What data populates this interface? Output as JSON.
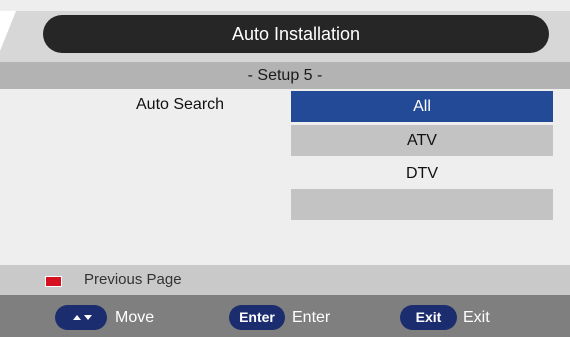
{
  "header": {
    "title": "Auto Installation",
    "subtitle": "- Setup 5 -"
  },
  "auto_search": {
    "label": "Auto Search",
    "options": [
      "All",
      "ATV",
      "DTV",
      ""
    ],
    "selected": "All"
  },
  "footer": {
    "previous_page_label": "Previous Page",
    "red_key_color": "#d6101f",
    "hints": {
      "move_label": "Move",
      "enter_key": "Enter",
      "enter_label": "Enter",
      "exit_key": "Exit",
      "exit_label": "Exit"
    }
  },
  "colors": {
    "selected_option": "#234a97",
    "title_pill": "#262626",
    "key_pill": "#1b2d6e"
  },
  "icons": {
    "move_key": "up-down-arrows-icon",
    "previous_page_key": "red-key-icon"
  }
}
